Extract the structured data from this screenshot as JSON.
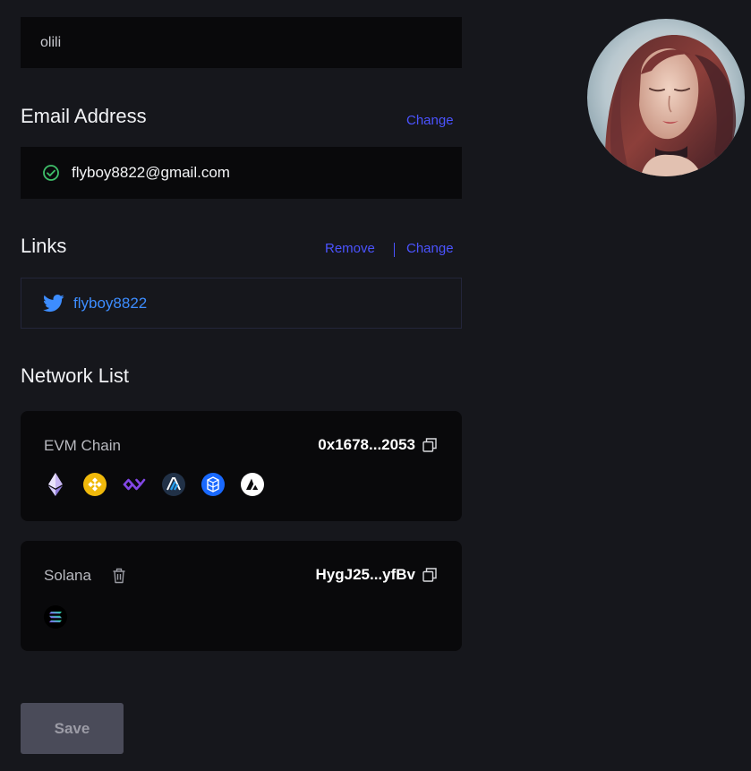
{
  "profile": {
    "name_value": "olili"
  },
  "email": {
    "title": "Email Address",
    "change_label": "Change",
    "value": "flyboy8822@gmail.com"
  },
  "links": {
    "title": "Links",
    "remove_label": "Remove",
    "change_label": "Change",
    "twitter_handle": "flyboy8822"
  },
  "networks": {
    "title": "Network List",
    "items": [
      {
        "name": "EVM Chain",
        "address": "0x1678...2053",
        "icons": [
          "ethereum-icon",
          "bnb-icon",
          "polygon-icon",
          "arbitrum-icon",
          "fantom-icon",
          "avalanche-icon"
        ]
      },
      {
        "name": "Solana",
        "address": "HygJ25...yfBv",
        "icons": [
          "solana-icon"
        ]
      }
    ]
  },
  "save_label": "Save",
  "colors": {
    "background": "#16171c",
    "field_bg": "#09090b",
    "link_accent": "#4b53ff",
    "twitter_blue": "#3d8dff",
    "verified_green": "#3fbf6a",
    "button_bg": "#4a4b59"
  }
}
